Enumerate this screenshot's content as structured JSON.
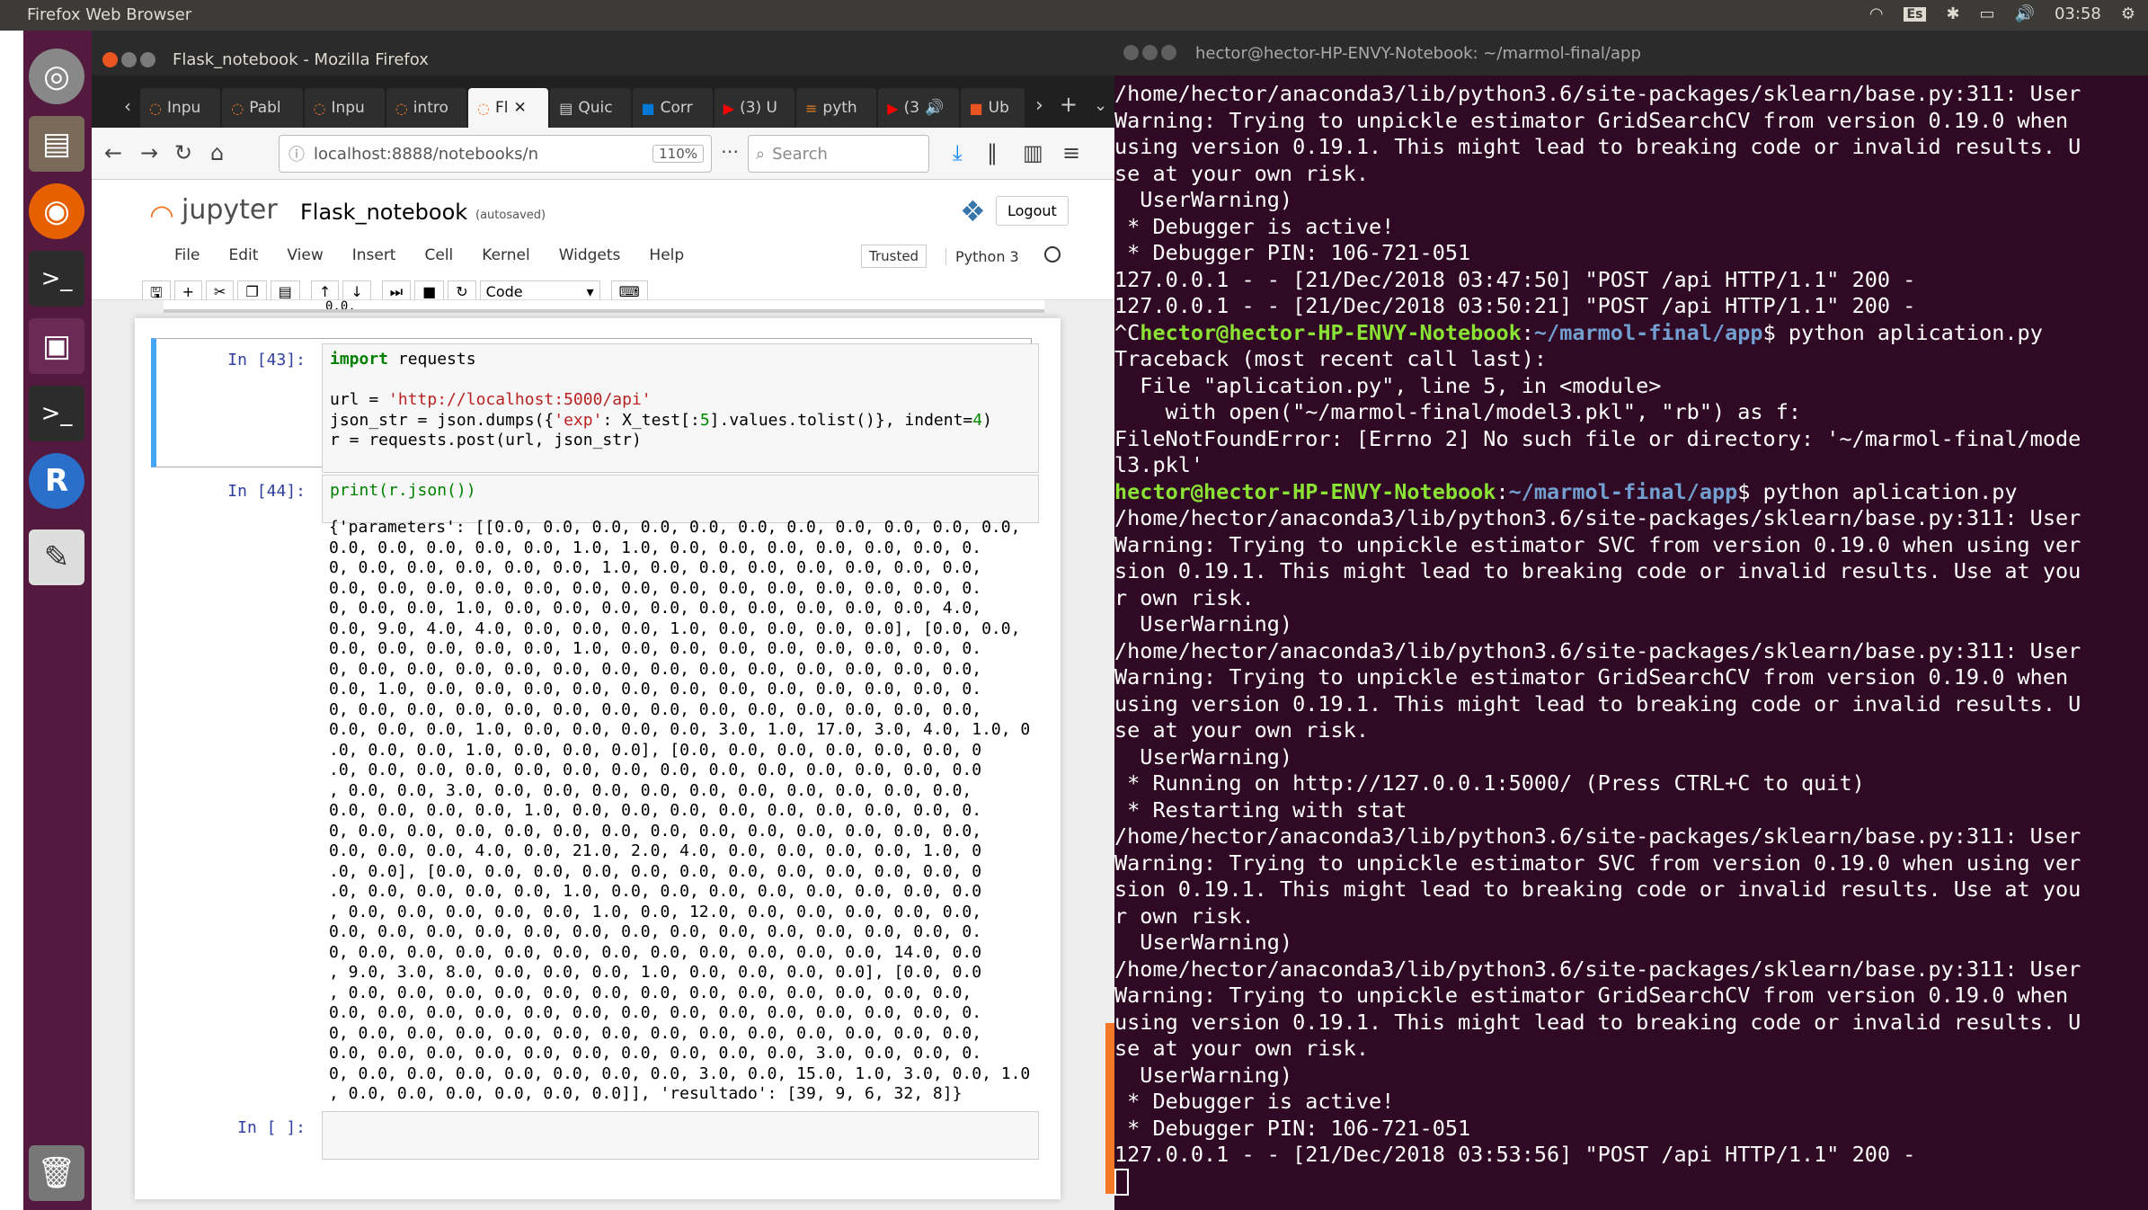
{
  "topbar": {
    "title": "Firefox Web Browser",
    "keyboard": "Es",
    "time": "03:58"
  },
  "launcher": [
    {
      "name": "ubuntu-dash-icon"
    },
    {
      "name": "files-icon"
    },
    {
      "name": "firefox-icon"
    },
    {
      "name": "terminal-icon"
    },
    {
      "name": "disk-icon"
    },
    {
      "name": "terminal2-icon"
    },
    {
      "name": "r-icon"
    },
    {
      "name": "text-editor-icon"
    },
    {
      "name": "trash-icon"
    }
  ],
  "firefox": {
    "window_title": "Flask_notebook - Mozilla Firefox",
    "tabs": [
      "Inpu",
      "Pabl",
      "Inpu",
      "intro",
      "Fl",
      "Quic",
      "Corr",
      "(3) U",
      "pyth",
      "(3",
      "Ub"
    ],
    "url": "localhost:8888/notebooks/n",
    "zoom": "110%",
    "search_placeholder": "Search"
  },
  "jupyter": {
    "logo": "jupyter",
    "notebook_name": "Flask_notebook",
    "autosave": "(autosaved)",
    "logout": "Logout",
    "menu": [
      "File",
      "Edit",
      "View",
      "Insert",
      "Cell",
      "Kernel",
      "Widgets",
      "Help"
    ],
    "trusted": "Trusted",
    "kernel": "Python 3",
    "cell_type": "Code",
    "truncated_output": "0.0,",
    "cells": [
      {
        "prompt": "In [43]:"
      },
      {
        "prompt": "In [44]:",
        "code": "print(r.json())"
      },
      {
        "prompt": "In [ ]:"
      }
    ],
    "output_lines": [
      "{'parameters': [[0.0, 0.0, 0.0, 0.0, 0.0, 0.0, 0.0, 0.0, 0.0, 0.0, 0.0,",
      "0.0, 0.0, 0.0, 0.0, 0.0, 1.0, 1.0, 0.0, 0.0, 0.0, 0.0, 0.0, 0.0, 0.",
      "0, 0.0, 0.0, 0.0, 0.0, 0.0, 1.0, 0.0, 0.0, 0.0, 0.0, 0.0, 0.0, 0.0,",
      "0.0, 0.0, 0.0, 0.0, 0.0, 0.0, 0.0, 0.0, 0.0, 0.0, 0.0, 0.0, 0.0, 0.",
      "0, 0.0, 0.0, 1.0, 0.0, 0.0, 0.0, 0.0, 0.0, 0.0, 0.0, 0.0, 0.0, 4.0,",
      "0.0, 9.0, 4.0, 4.0, 0.0, 0.0, 0.0, 1.0, 0.0, 0.0, 0.0, 0.0], [0.0, 0.0,",
      "0.0, 0.0, 0.0, 0.0, 0.0, 1.0, 0.0, 0.0, 0.0, 0.0, 0.0, 0.0, 0.0, 0.",
      "0, 0.0, 0.0, 0.0, 0.0, 0.0, 0.0, 0.0, 0.0, 0.0, 0.0, 0.0, 0.0, 0.0,",
      "0.0, 1.0, 0.0, 0.0, 0.0, 0.0, 0.0, 0.0, 0.0, 0.0, 0.0, 0.0, 0.0, 0.",
      "0, 0.0, 0.0, 0.0, 0.0, 0.0, 0.0, 0.0, 0.0, 0.0, 0.0, 0.0, 0.0, 0.0,",
      "0.0, 0.0, 0.0, 1.0, 0.0, 0.0, 0.0, 0.0, 3.0, 1.0, 17.0, 3.0, 4.0, 1.0, 0",
      ".0, 0.0, 0.0, 1.0, 0.0, 0.0, 0.0], [0.0, 0.0, 0.0, 0.0, 0.0, 0.0, 0",
      ".0, 0.0, 0.0, 0.0, 0.0, 0.0, 0.0, 0.0, 0.0, 0.0, 0.0, 0.0, 0.0, 0.0",
      ", 0.0, 0.0, 3.0, 0.0, 0.0, 0.0, 0.0, 0.0, 0.0, 0.0, 0.0, 0.0, 0.0,",
      "0.0, 0.0, 0.0, 0.0, 1.0, 0.0, 0.0, 0.0, 0.0, 0.0, 0.0, 0.0, 0.0, 0.",
      "0, 0.0, 0.0, 0.0, 0.0, 0.0, 0.0, 0.0, 0.0, 0.0, 0.0, 0.0, 0.0, 0.0,",
      "0.0, 0.0, 0.0, 4.0, 0.0, 21.0, 2.0, 4.0, 0.0, 0.0, 0.0, 0.0, 1.0, 0",
      ".0, 0.0], [0.0, 0.0, 0.0, 0.0, 0.0, 0.0, 0.0, 0.0, 0.0, 0.0, 0.0, 0",
      ".0, 0.0, 0.0, 0.0, 0.0, 1.0, 0.0, 0.0, 0.0, 0.0, 0.0, 0.0, 0.0, 0.0",
      ", 0.0, 0.0, 0.0, 0.0, 0.0, 1.0, 0.0, 12.0, 0.0, 0.0, 0.0, 0.0, 0.0,",
      "0.0, 0.0, 0.0, 0.0, 0.0, 0.0, 0.0, 0.0, 0.0, 0.0, 0.0, 0.0, 0.0, 0.",
      "0, 0.0, 0.0, 0.0, 0.0, 0.0, 0.0, 0.0, 0.0, 0.0, 0.0, 0.0, 14.0, 0.0",
      ", 9.0, 3.0, 8.0, 0.0, 0.0, 0.0, 1.0, 0.0, 0.0, 0.0, 0.0], [0.0, 0.0",
      ", 0.0, 0.0, 0.0, 0.0, 0.0, 0.0, 0.0, 0.0, 0.0, 0.0, 0.0, 0.0, 0.0,",
      "0.0, 0.0, 0.0, 0.0, 0.0, 0.0, 0.0, 0.0, 0.0, 0.0, 0.0, 0.0, 0.0, 0.",
      "0, 0.0, 0.0, 0.0, 0.0, 0.0, 0.0, 0.0, 0.0, 0.0, 0.0, 0.0, 0.0, 0.0,",
      "0.0, 0.0, 0.0, 0.0, 0.0, 0.0, 0.0, 0.0, 0.0, 0.0, 3.0, 0.0, 0.0, 0.",
      "0, 0.0, 0.0, 0.0, 0.0, 0.0, 0.0, 0.0, 3.0, 0.0, 15.0, 1.0, 3.0, 0.0, 1.0",
      ", 0.0, 0.0, 0.0, 0.0, 0.0, 0.0]], 'resultado': [39, 9, 6, 32, 8]}"
    ]
  },
  "terminal": {
    "title": "hector@hector-HP-ENVY-Notebook: ~/marmol-final/app",
    "prompt_user": "hector@hector-HP-ENVY-Notebook",
    "prompt_path": "~/marmol-final/app",
    "command": "$ python aplication.py",
    "lines": [
      "/home/hector/anaconda3/lib/python3.6/site-packages/sklearn/base.py:311: User",
      "Warning: Trying to unpickle estimator GridSearchCV from version 0.19.0 when",
      "using version 0.19.1. This might lead to breaking code or invalid results. U",
      "se at your own risk.",
      "  UserWarning)",
      " * Debugger is active!",
      " * Debugger PIN: 106-721-051",
      "127.0.0.1 - - [21/Dec/2018 03:47:50] \"POST /api HTTP/1.1\" 200 -",
      "127.0.0.1 - - [21/Dec/2018 03:50:21] \"POST /api HTTP/1.1\" 200 -"
    ],
    "ctrl_c": "^C",
    "lines2": [
      "Traceback (most recent call last):",
      "  File \"aplication.py\", line 5, in <module>",
      "    with open(\"~/marmol-final/model3.pkl\", \"rb\") as f:",
      "FileNotFoundError: [Errno 2] No such file or directory: '~/marmol-final/mode",
      "l3.pkl'"
    ],
    "lines3": [
      "/home/hector/anaconda3/lib/python3.6/site-packages/sklearn/base.py:311: User",
      "Warning: Trying to unpickle estimator SVC from version 0.19.0 when using ver",
      "sion 0.19.1. This might lead to breaking code or invalid results. Use at you",
      "r own risk.",
      "  UserWarning)",
      "/home/hector/anaconda3/lib/python3.6/site-packages/sklearn/base.py:311: User",
      "Warning: Trying to unpickle estimator GridSearchCV from version 0.19.0 when",
      "using version 0.19.1. This might lead to breaking code or invalid results. U",
      "se at your own risk.",
      "  UserWarning)",
      " * Running on http://127.0.0.1:5000/ (Press CTRL+C to quit)",
      " * Restarting with stat",
      "/home/hector/anaconda3/lib/python3.6/site-packages/sklearn/base.py:311: User",
      "Warning: Trying to unpickle estimator SVC from version 0.19.0 when using ver",
      "sion 0.19.1. This might lead to breaking code or invalid results. Use at you",
      "r own risk.",
      "  UserWarning)",
      "/home/hector/anaconda3/lib/python3.6/site-packages/sklearn/base.py:311: User",
      "Warning: Trying to unpickle estimator GridSearchCV from version 0.19.0 when",
      "using version 0.19.1. This might lead to breaking code or invalid results. U",
      "se at your own risk.",
      "  UserWarning)",
      " * Debugger is active!",
      " * Debugger PIN: 106-721-051",
      "127.0.0.1 - - [21/Dec/2018 03:53:56] \"POST /api HTTP/1.1\" 200 -"
    ]
  }
}
